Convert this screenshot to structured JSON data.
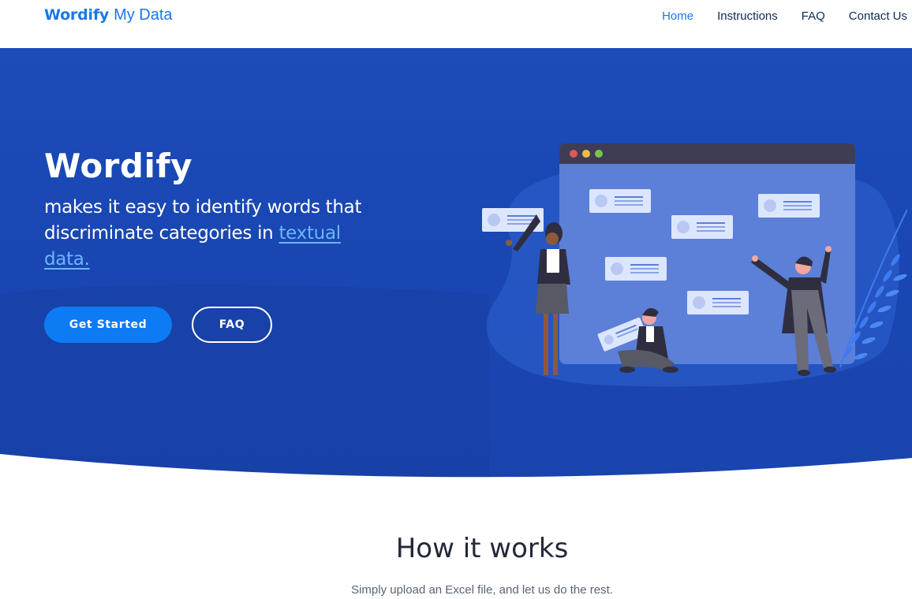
{
  "navbar": {
    "brand_logo": "Wordify",
    "brand_suffix": "My Data",
    "links": [
      "Home",
      "Instructions",
      "FAQ",
      "Contact Us"
    ],
    "active_link": "Home"
  },
  "hero": {
    "title": "Wordify",
    "description_text": "makes it easy to identify words that discriminate categories in",
    "description_link": "textual data.",
    "primary_button": "Get Started",
    "secondary_button": "FAQ"
  },
  "how_it_works": {
    "title": "How it works",
    "subtitle": "Simply upload an Excel file, and let us do the rest."
  },
  "colors": {
    "accent": "#1a77e8",
    "hero_bg": "#1947b3",
    "primary_button": "#0d7bf3",
    "link_highlight": "#6cb6ff",
    "heading": "#23273a"
  }
}
